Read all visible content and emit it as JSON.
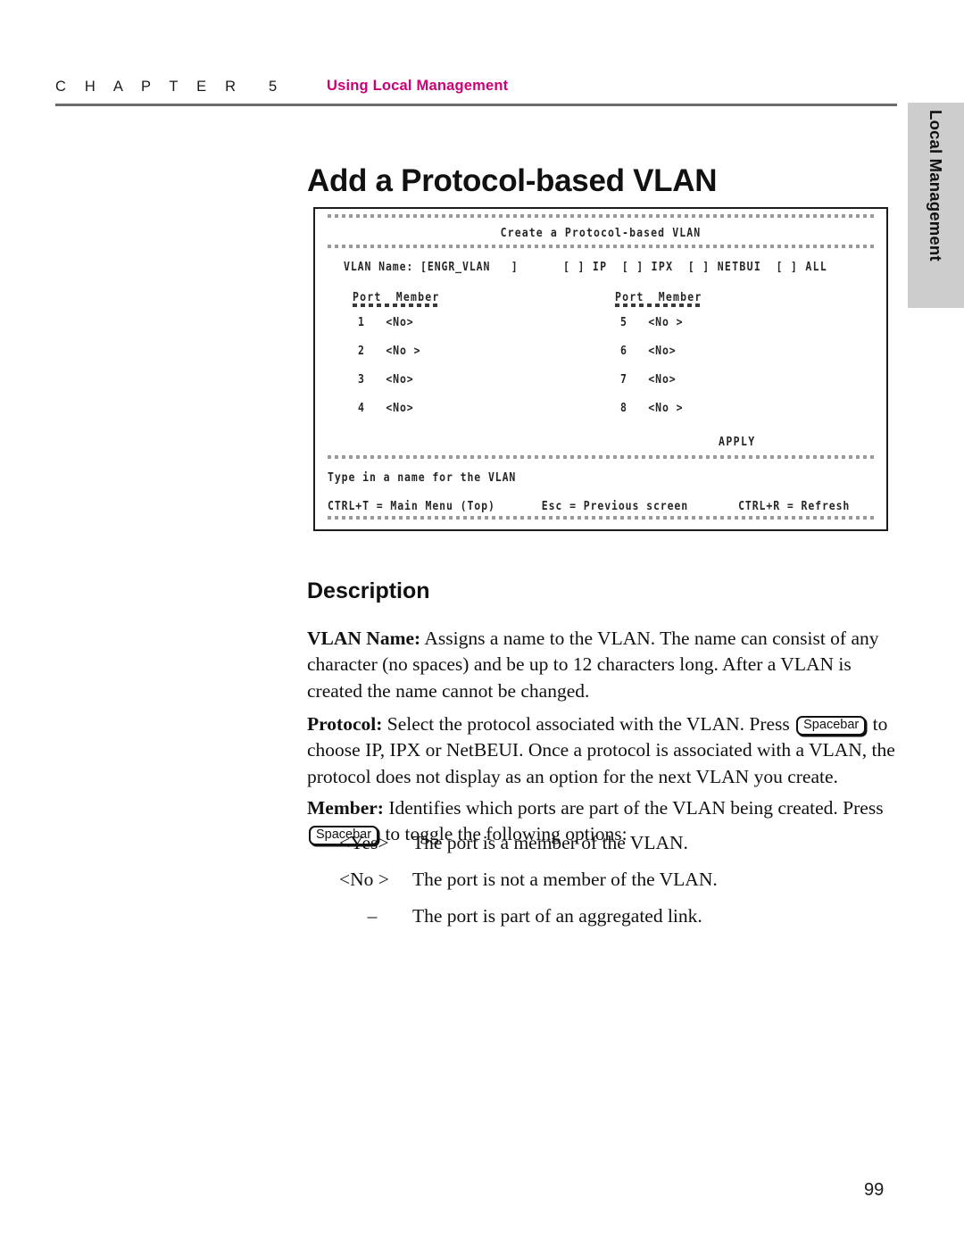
{
  "header": {
    "chapter_word": "C H A P T E R",
    "chapter_number": "5",
    "subject": "Using Local Management"
  },
  "side_tab": {
    "label": "Local Management"
  },
  "page_title": "Add a Protocol-based VLAN",
  "terminal": {
    "title": "Create a Protocol-based VLAN",
    "vlan_name_line": "VLAN Name: [ENGR_VLAN   ]",
    "protocol_line": "[ ] IP  [ ] IPX  [ ] NETBUI  [ ] ALL",
    "table_header_left": "Port  Member",
    "table_header_right": "Port  Member",
    "rows_left": [
      {
        "port": "1",
        "member": "<No>"
      },
      {
        "port": "2",
        "member": "<No >"
      },
      {
        "port": "3",
        "member": "<No>"
      },
      {
        "port": "4",
        "member": "<No>"
      }
    ],
    "rows_right": [
      {
        "port": "5",
        "member": "<No >"
      },
      {
        "port": "6",
        "member": "<No>"
      },
      {
        "port": "7",
        "member": "<No>"
      },
      {
        "port": "8",
        "member": "<No >"
      }
    ],
    "apply_label": "APPLY",
    "prompt": "Type in a name for the VLAN",
    "key_hint_1": "CTRL+T = Main Menu (Top)",
    "key_hint_2": "Esc = Previous screen",
    "key_hint_3": "CTRL+R = Refresh"
  },
  "description": {
    "heading": "Description",
    "vlan_name": {
      "term": "VLAN Name:",
      "text": " Assigns a name to the VLAN. The name can consist of any character (no spaces) and be up to 12 characters long. After a VLAN is created the name cannot be changed."
    },
    "protocol": {
      "term": "Protocol:",
      "text_before_key": " Select the protocol associated with the VLAN. Press ",
      "key_label": "Spacebar",
      "text_after_key": " to choose IP, IPX or NetBEUI. Once a protocol is associated with a VLAN, the protocol does not display as an option for the next VLAN you create."
    },
    "member": {
      "term": "Member:",
      "text_before_key": " Identifies which ports are part of the VLAN being created. Press ",
      "key_label": "Spacebar",
      "text_after_key": " to toggle the following options:"
    },
    "options": [
      {
        "token": "<Yes>",
        "desc": "The port is a member of the VLAN."
      },
      {
        "token": "<No >",
        "desc": "The port is not a member of the VLAN."
      },
      {
        "token": "–",
        "desc": "The port is part of an aggregated link."
      }
    ]
  },
  "page_number": "99",
  "colors": {
    "accent": "#cc0077",
    "rule": "#6b6b6b",
    "tab_bg": "#cdcdcd"
  }
}
